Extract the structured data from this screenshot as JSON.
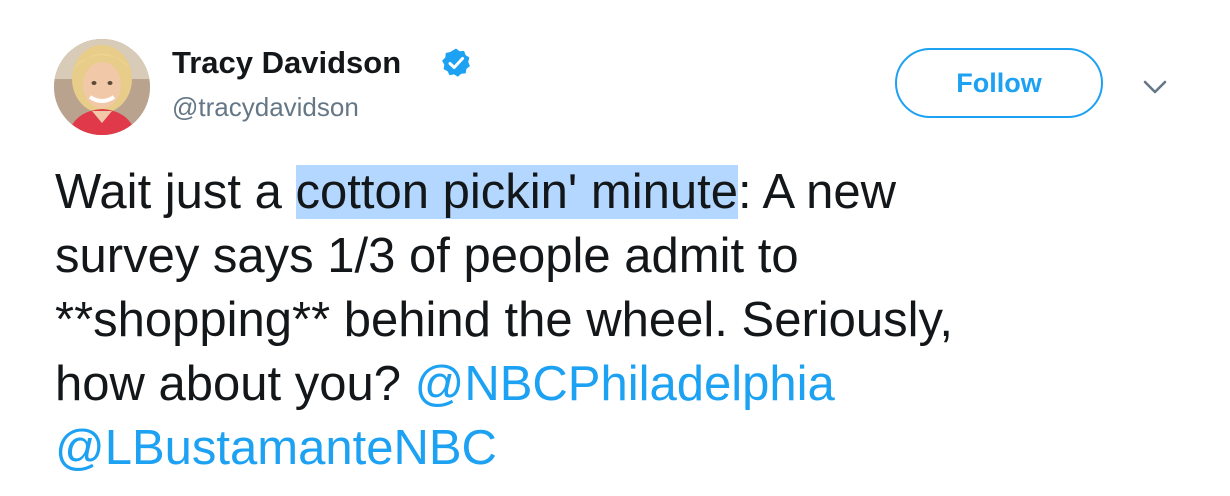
{
  "user": {
    "display_name": "Tracy Davidson",
    "screen_name": "@tracydavidson",
    "verified_icon": "verified-badge-icon",
    "avatar_icon": "avatar"
  },
  "actions": {
    "follow_label": "Follow",
    "menu_icon": "chevron-down-icon"
  },
  "tweet": {
    "line1_before": "Wait just a ",
    "line1_highlight": "cotton pickin' minute",
    "line1_after": ": A new",
    "line2": "survey says 1/3 of people admit to",
    "line3": "**shopping** behind the wheel. Seriously,",
    "line4_before": "how about you? ",
    "mention1": "@NBCPhiladelphia",
    "mention2": "@LBustamanteNBC"
  },
  "colors": {
    "accent": "#1da1f2",
    "text": "#14171a",
    "muted": "#657786",
    "selection": "#b3d7fe"
  }
}
